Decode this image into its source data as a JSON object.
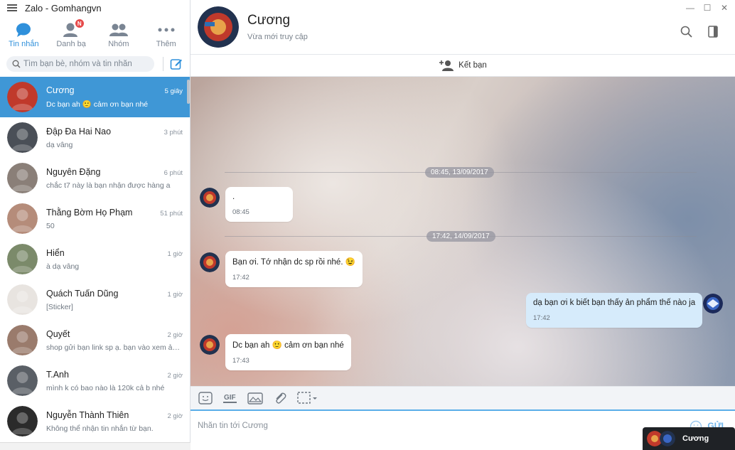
{
  "app": {
    "title": "Zalo - Gomhangvn"
  },
  "nav": {
    "tabs": [
      {
        "label": "Tin nhắn",
        "icon": "chat-bubble-icon",
        "active": true
      },
      {
        "label": "Danh bạ",
        "icon": "contacts-icon",
        "badge": "N"
      },
      {
        "label": "Nhóm",
        "icon": "group-icon"
      },
      {
        "label": "Thêm",
        "icon": "more-dots-icon"
      }
    ]
  },
  "search": {
    "placeholder": "Tìm bạn bè, nhóm và tin nhắn"
  },
  "conversations": [
    {
      "name": "Cương",
      "time": "5 giây",
      "preview": "Dc bạn ah 🙂 cảm ơn bạn nhé",
      "active": true,
      "avatar_color": "#c0392b"
    },
    {
      "name": "Đập Đa Hai Nao",
      "time": "3 phút",
      "preview": "dạ vâng",
      "avatar_color": "#4a4f57"
    },
    {
      "name": "Nguyên Đặng",
      "time": "6 phút",
      "preview": "chắc t7 này là bạn nhận được hàng a",
      "avatar_color": "#8a7f78"
    },
    {
      "name": "Thằng Bờm Họ Phạm",
      "time": "51 phút",
      "preview": "50",
      "avatar_color": "#b58c7a"
    },
    {
      "name": "Hiển",
      "time": "1 giờ",
      "preview": "à dạ vâng",
      "avatar_color": "#7b8a6a"
    },
    {
      "name": "Quách Tuấn Dũng",
      "time": "1 giờ",
      "preview": "[Sticker]",
      "avatar_color": "#e8e4e0"
    },
    {
      "name": "Quyết",
      "time": "2 giờ",
      "preview": "shop gửi bạn link sp ạ. bạn vào xem ản...",
      "avatar_color": "#9a7b6c"
    },
    {
      "name": "T.Anh",
      "time": "2 giờ",
      "preview": "mình k có bao nào là 120k cả b nhé",
      "avatar_color": "#5a5f66"
    },
    {
      "name": "Nguyễn Thành Thiên",
      "time": "2 giờ",
      "preview": "Không thể nhận tin nhắn từ bạn.",
      "avatar_color": "#2b2b2b"
    }
  ],
  "chat": {
    "contact_name": "Cương",
    "status": "Vừa mới truy cập",
    "add_friend_label": "Kết bạn",
    "date_separators": [
      "08:45, 13/09/2017",
      "17:42, 14/09/2017"
    ],
    "messages": [
      {
        "from": "them",
        "text": ".",
        "time": "08:45"
      },
      {
        "from": "them",
        "text": "Bạn ơi. Tớ nhận dc sp rồi nhé. 😉",
        "time": "17:42"
      },
      {
        "from": "me",
        "text": "dạ bạn ơi k biết bạn thấy ản phẩm thế nào ja",
        "time": "17:42"
      },
      {
        "from": "them",
        "text": "Dc bạn ah 🙂 cảm ơn bạn nhé",
        "time": "17:43"
      }
    ],
    "input_placeholder": "Nhắn tin tới Cương",
    "send_label": "GỬI",
    "toolbar": {
      "gif_label": "GIF"
    }
  },
  "popup": {
    "name": "Cương"
  },
  "colors": {
    "accent": "#3f97d6",
    "active_tab": "#2f90db",
    "my_bubble": "#d6ebfb",
    "badge": "#e64a4a"
  }
}
